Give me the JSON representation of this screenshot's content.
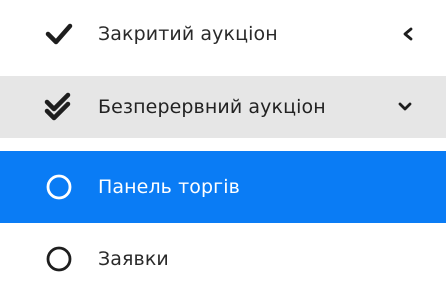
{
  "menu": {
    "items": [
      {
        "label": "Закритий аукціон",
        "icon": "check-icon",
        "arrow": "chevron-left-icon",
        "state": "collapsed"
      },
      {
        "label": "Безперервний аукціон",
        "icon": "double-check-icon",
        "arrow": "chevron-down-icon",
        "state": "expanded"
      },
      {
        "label": "Панель торгів",
        "icon": "circle-icon",
        "state": "selected"
      },
      {
        "label": "Заявки",
        "icon": "circle-icon",
        "state": "normal"
      }
    ]
  },
  "colors": {
    "selected_background": "#0a7cf5",
    "expanded_background": "#e6e6e6",
    "text": "#2a2a2a",
    "selected_text": "#ffffff"
  }
}
